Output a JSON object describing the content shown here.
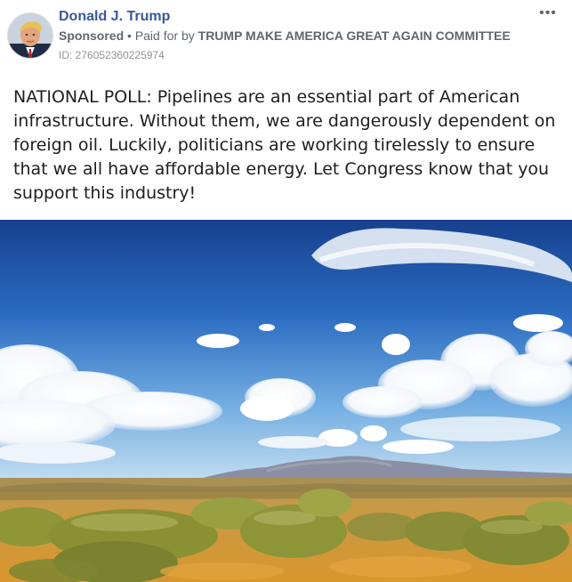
{
  "ad": {
    "page_name": "Donald J. Trump",
    "sponsored_label": "Sponsored",
    "separator": "•",
    "paid_for_prefix": "Paid for by",
    "paid_for_by": "TRUMP MAKE AMERICA GREAT AGAIN COMMITTEE",
    "ad_id": "ID: 276052360225974",
    "more_label": "•••",
    "body_text": "NATIONAL POLL: Pipelines are an essential part of American infrastructure. Without them, we are dangerously dependent on foreign oil. Luckily, politicians are working tirelessly to ensure that we all have affordable energy. Let Congress know that you support this industry!"
  },
  "icons": [
    "avatar-photo",
    "more-options-icon"
  ],
  "colors": {
    "page_name": "#385898",
    "meta_text": "#606770",
    "body_text": "#1c1e21",
    "sky_top": "#1a4a9a",
    "sky_horizon": "#bfdcf3",
    "desert": "#c98f3a",
    "sagebrush": "#8f9638"
  }
}
